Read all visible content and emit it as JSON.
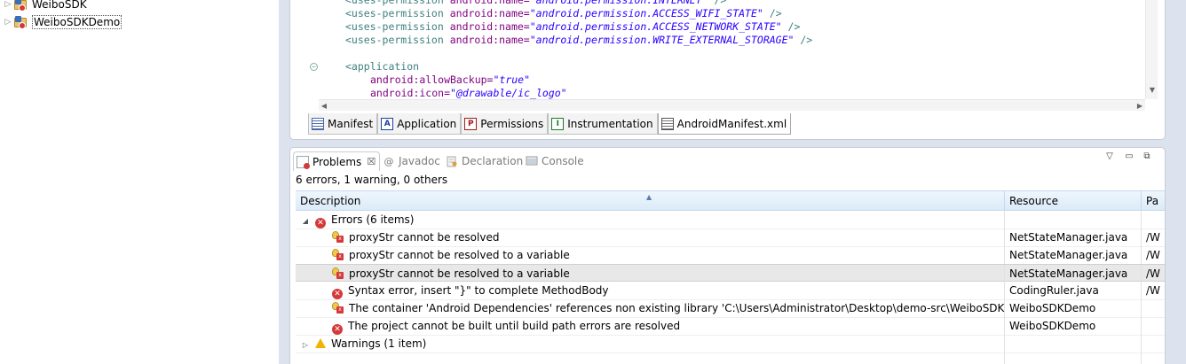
{
  "explorer": {
    "projects": [
      {
        "label": "WeiboSDK",
        "selected": false
      },
      {
        "label": "WeiboSDKDemo",
        "selected": true
      }
    ]
  },
  "editor": {
    "code_lines": [
      {
        "indent": 4,
        "tag": "<uses-permission",
        "attr": "android:name=",
        "val": "\"android.permission.INTERNET\"",
        "end": " />"
      },
      {
        "indent": 4,
        "tag": "<uses-permission",
        "attr": "android:name=",
        "val": "\"android.permission.ACCESS_WIFI_STATE\"",
        "end": " />"
      },
      {
        "indent": 4,
        "tag": "<uses-permission",
        "attr": "android:name=",
        "val": "\"android.permission.ACCESS_NETWORK_STATE\"",
        "end": " />"
      },
      {
        "indent": 4,
        "tag": "<uses-permission",
        "attr": "android:name=",
        "val": "\"android.permission.WRITE_EXTERNAL_STORAGE\"",
        "end": " />"
      },
      {
        "indent": 0,
        "tag": "",
        "attr": "",
        "val": "",
        "end": ""
      },
      {
        "indent": 4,
        "tag": "<application",
        "attr": "",
        "val": "",
        "end": ""
      },
      {
        "indent": 8,
        "tag": "",
        "attr": "android:allowBackup=",
        "val": "\"true\"",
        "end": ""
      },
      {
        "indent": 8,
        "tag": "",
        "attr": "android:icon=",
        "val": "\"@drawable/ic_logo\"",
        "end": ""
      }
    ],
    "tabs": [
      {
        "label": "Manifest",
        "icon": "manifest-icon",
        "icon_char": ""
      },
      {
        "label": "Application",
        "icon": "application-icon",
        "icon_char": "A"
      },
      {
        "label": "Permissions",
        "icon": "permissions-icon",
        "icon_char": "P"
      },
      {
        "label": "Instrumentation",
        "icon": "instrumentation-icon",
        "icon_char": "I"
      },
      {
        "label": "AndroidManifest.xml",
        "icon": "xml-file-icon",
        "icon_char": ""
      }
    ],
    "active_tab": "AndroidManifest.xml"
  },
  "problems": {
    "tabs": [
      {
        "label": "Problems",
        "icon": "problems-icon",
        "active": true
      },
      {
        "label": "Javadoc",
        "icon": "at-icon",
        "icon_char": "@",
        "active": false
      },
      {
        "label": "Declaration",
        "icon": "declaration-icon",
        "active": false
      },
      {
        "label": "Console",
        "icon": "console-icon",
        "active": false
      }
    ],
    "close_char": "☒",
    "summary": "6 errors, 1 warning, 0 others",
    "columns": {
      "description": "Description",
      "resource": "Resource",
      "path": "Pa"
    },
    "errors_group": "Errors (6 items)",
    "warnings_group": "Warnings (1 item)",
    "rows": [
      {
        "icon": "quickfix-error-icon",
        "description": "proxyStr cannot be resolved",
        "resource": "NetStateManager.java",
        "path": "/W"
      },
      {
        "icon": "quickfix-error-icon",
        "description": "proxyStr cannot be resolved to a variable",
        "resource": "NetStateManager.java",
        "path": "/W"
      },
      {
        "icon": "quickfix-error-icon",
        "description": "proxyStr cannot be resolved to a variable",
        "resource": "NetStateManager.java",
        "path": "/W",
        "highlight": true
      },
      {
        "icon": "error-icon",
        "description": "Syntax error, insert \"}\" to complete MethodBody",
        "resource": "CodingRuler.java",
        "path": "/W"
      },
      {
        "icon": "quickfix-error-icon",
        "description": "The container 'Android Dependencies' references non existing library 'C:\\Users\\Administrator\\Desktop\\demo-src\\WeiboSDK\\b",
        "resource": "WeiboSDKDemo",
        "path": ""
      },
      {
        "icon": "error-icon",
        "description": "The project cannot be built until build path errors are resolved",
        "resource": "WeiboSDKDemo",
        "path": ""
      }
    ]
  },
  "colors": {
    "error": "#d43939",
    "warning": "#f0b300",
    "workspace_bg": "#dde3ee",
    "header_bg": "#dcebf8"
  }
}
